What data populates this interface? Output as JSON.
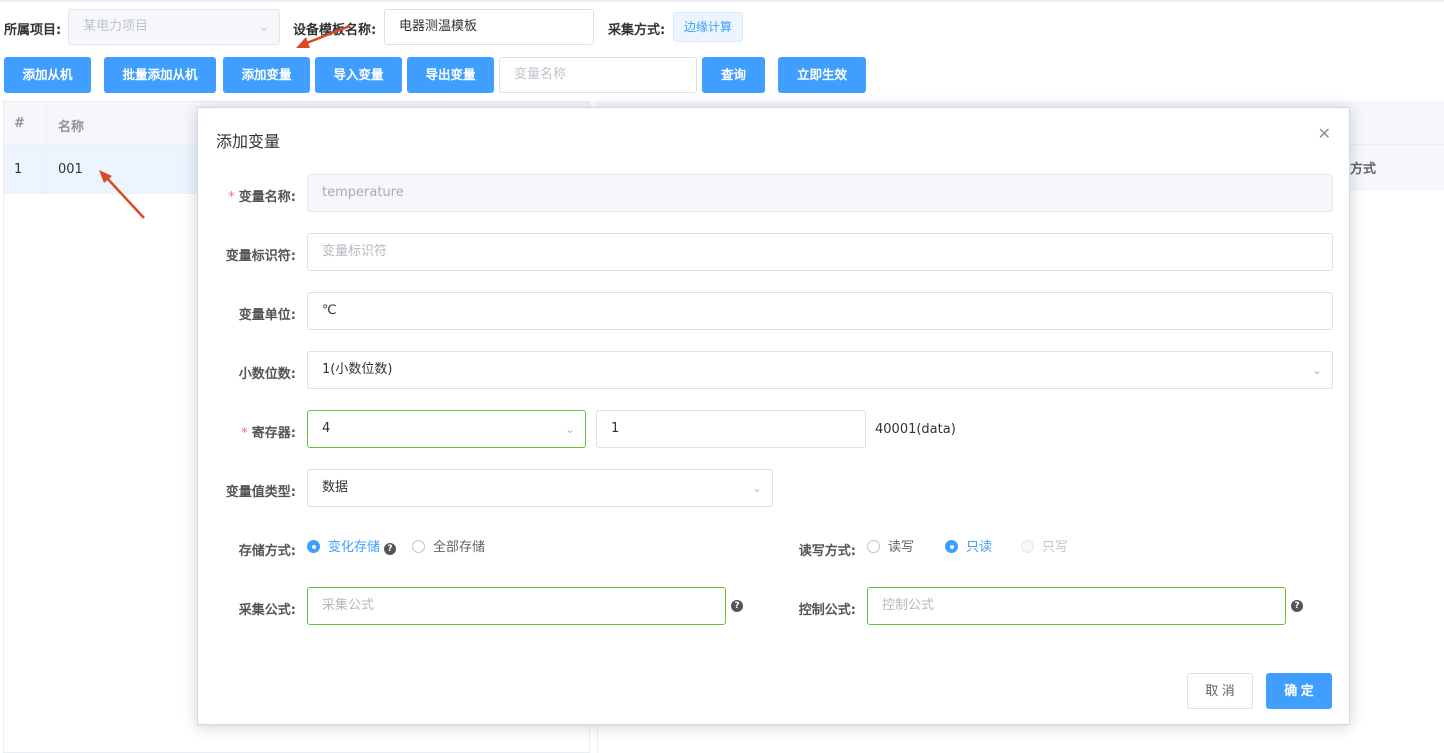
{
  "filters": {
    "project_label": "所属项目:",
    "project_value": "某电力项目",
    "template_label": "设备模板名称:",
    "template_value": "电器测温模板",
    "collect_label": "采集方式:",
    "collect_value": "边缘计算"
  },
  "toolbar": {
    "add_slave": "添加从机",
    "batch_add_slave": "批量添加从机",
    "add_variable": "添加变量",
    "import_variable": "导入变量",
    "export_variable": "导出变量",
    "search_placeholder": "变量名称",
    "query": "查询",
    "apply_now": "立即生效"
  },
  "slave_table": {
    "headers": [
      "#",
      "名称"
    ],
    "rows": [
      {
        "index": "1",
        "name": "001"
      }
    ]
  },
  "variable_table": {
    "partial_header": "方式"
  },
  "dialog": {
    "title": "添加变量",
    "close_icon": "close-icon",
    "fields": {
      "name": {
        "label": "变量名称:",
        "value": "temperature",
        "required": true
      },
      "identifier": {
        "label": "变量标识符:",
        "placeholder": "变量标识符"
      },
      "unit": {
        "label": "变量单位:",
        "value": "℃"
      },
      "decimals": {
        "label": "小数位数:",
        "value": "1(小数位数)"
      },
      "register": {
        "label": "寄存器:",
        "type_value": "4",
        "address_value": "1",
        "display": "40001(data)",
        "required": true
      },
      "value_type": {
        "label": "变量值类型:",
        "value": "数据"
      },
      "storage": {
        "label": "存储方式:",
        "options": [
          "变化存储",
          "全部存储"
        ],
        "selected": "变化存储"
      },
      "rw": {
        "label": "读写方式:",
        "options": [
          "读写",
          "只读",
          "只写"
        ],
        "selected": "只读"
      },
      "collect_formula": {
        "label": "采集公式:",
        "placeholder": "采集公式"
      },
      "control_formula": {
        "label": "控制公式:",
        "placeholder": "控制公式"
      }
    },
    "cancel": "取 消",
    "confirm": "确 定"
  },
  "colors": {
    "primary": "#409eff",
    "success_border": "#67c23a",
    "required": "#f56c6c",
    "annotation_arrow": "#d94a24"
  }
}
